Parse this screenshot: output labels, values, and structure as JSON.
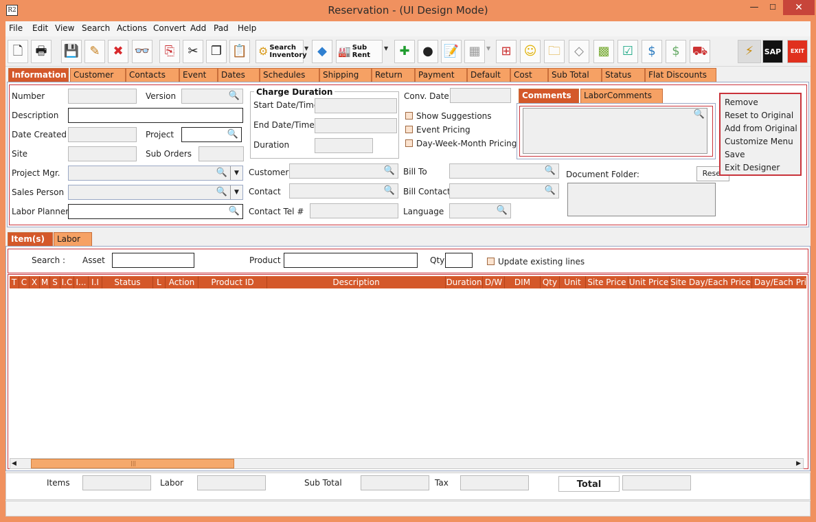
{
  "window": {
    "title": "Reservation - (UI Design Mode)",
    "app_icon": "R2",
    "min": "—",
    "max": "☐",
    "close": "✕"
  },
  "menu": [
    "File",
    "Edit",
    "View",
    "Search",
    "Actions",
    "Convert",
    "Add",
    "Pad",
    "Help"
  ],
  "toolbar": {
    "search_inventory": "Search\nInventory",
    "search_inventory_1": "Search",
    "search_inventory_2": "Inventory",
    "sub_rent": "Sub Rent",
    "sap": "SAP",
    "exit": "EXIT"
  },
  "tabs": [
    "Information",
    "Customer",
    "Contacts",
    "Event",
    "Dates",
    "Schedules",
    "Shipping",
    "Return",
    "Payment",
    "Default",
    "Cost",
    "Sub Total",
    "Status",
    "Flat Discounts"
  ],
  "info": {
    "number_label": "Number",
    "version_label": "Version",
    "description_label": "Description",
    "date_created_label": "Date Created",
    "project_label": "Project",
    "site_label": "Site",
    "sub_orders_label": "Sub Orders",
    "project_mgr_label": "Project Mgr.",
    "sales_person_label": "Sales Person",
    "labor_planner_label": "Labor Planner",
    "charge_duration_title": "Charge Duration",
    "start_label": "Start Date/Time",
    "end_label": "End Date/Time",
    "duration_label": "Duration",
    "conv_date_label": "Conv. Date",
    "show_suggestions": "Show Suggestions",
    "event_pricing": "Event Pricing",
    "dwm_pricing": "Day-Week-Month Pricing",
    "customer_label": "Customer",
    "contact_label": "Contact",
    "contact_tel_label": "Contact Tel #",
    "bill_to_label": "Bill To",
    "bill_contact_label": "Bill Contact",
    "language_label": "Language",
    "document_folder_label": "Document Folder:",
    "reset_button": "Reset"
  },
  "comment_tabs": [
    "Comments",
    "LaborComments"
  ],
  "context_menu": [
    "Remove",
    "Reset to Original",
    "Add from Original",
    "Customize Menu",
    "Save",
    "Exit Designer"
  ],
  "item_tabs": [
    "Item(s)",
    "Labor"
  ],
  "search_row": {
    "search_label": "Search :",
    "asset_label": "Asset",
    "product_label": "Product",
    "qty_label": "Qty",
    "update_existing": "Update existing lines"
  },
  "grid_columns": [
    "T",
    "C",
    "X",
    "M",
    "S",
    "I.C",
    "I...",
    "I.I",
    "Status",
    "L",
    "Action",
    "Product ID",
    "Description",
    "Duration",
    "D/W",
    "DIM",
    "Qty",
    "Unit",
    "Site Price",
    "Unit Price",
    "Site Day/Each Price",
    "Day/Each Price"
  ],
  "totals": {
    "items_label": "Items",
    "labor_label": "Labor",
    "sub_total_label": "Sub Total",
    "tax_label": "Tax",
    "total_label": "Total"
  },
  "colors": {
    "accent": "#f0915f",
    "active_tab": "#d4582a",
    "tab": "#f6a164",
    "design_border": "#c9323a"
  }
}
